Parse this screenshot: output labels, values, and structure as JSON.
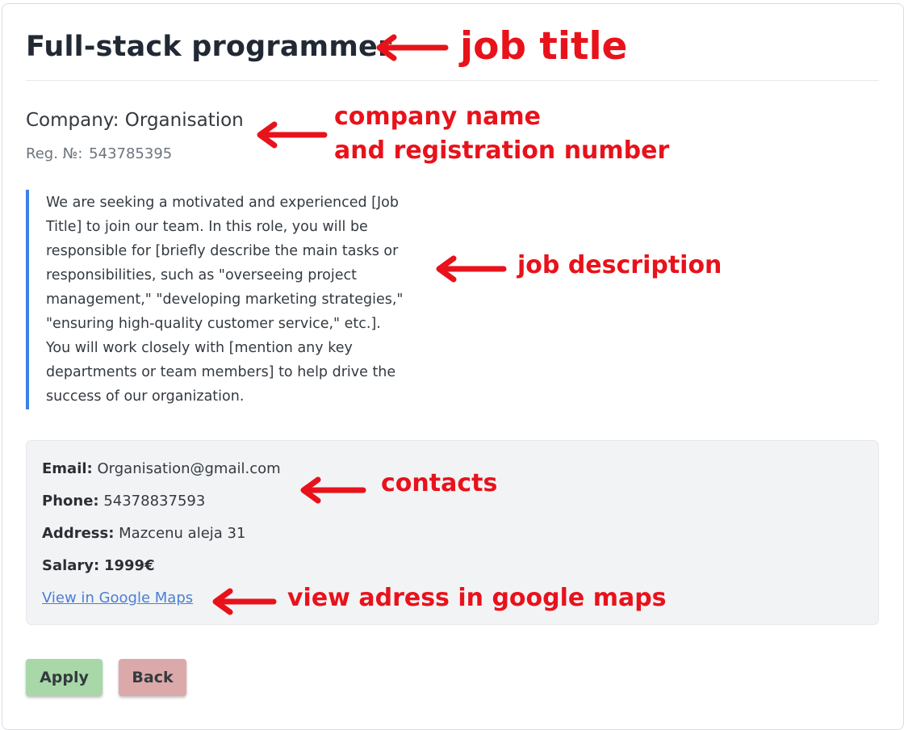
{
  "job": {
    "title": "Full-stack programmer",
    "company": "Company: Organisation",
    "reg_label": "Reg. №:",
    "reg_number": "543785395",
    "description": "We are seeking a motivated and experienced [Job Title] to join our team. In this role, you will be responsible for [briefly describe the main tasks or responsibilities, such as \"overseeing project management,\" \"developing marketing strategies,\" \"ensuring high-quality customer service,\" etc.]. You will work closely with [mention any key departments or team members] to help drive the success of our organization."
  },
  "contacts": {
    "email_label": "Email:",
    "email_value": "Organisation@gmail.com",
    "phone_label": "Phone:",
    "phone_value": "54378837593",
    "address_label": "Address:",
    "address_value": "Mazcenu aleja 31",
    "salary_label": "Salary:",
    "salary_value": "1999€",
    "maps_link": "View in Google Maps"
  },
  "actions": {
    "apply_label": "Apply",
    "back_label": "Back"
  },
  "annotations": {
    "job_title": "job title",
    "company_line1": "company name",
    "company_line2": "and registration number",
    "job_description": "job description",
    "contacts": "contacts",
    "maps": "view adress in google maps"
  },
  "colors": {
    "annotation": "#e8121b",
    "accent_border": "#3b82e6",
    "apply_button": "#a8d8a8",
    "back_button": "#dba9a9",
    "link": "#4a7fd4"
  }
}
